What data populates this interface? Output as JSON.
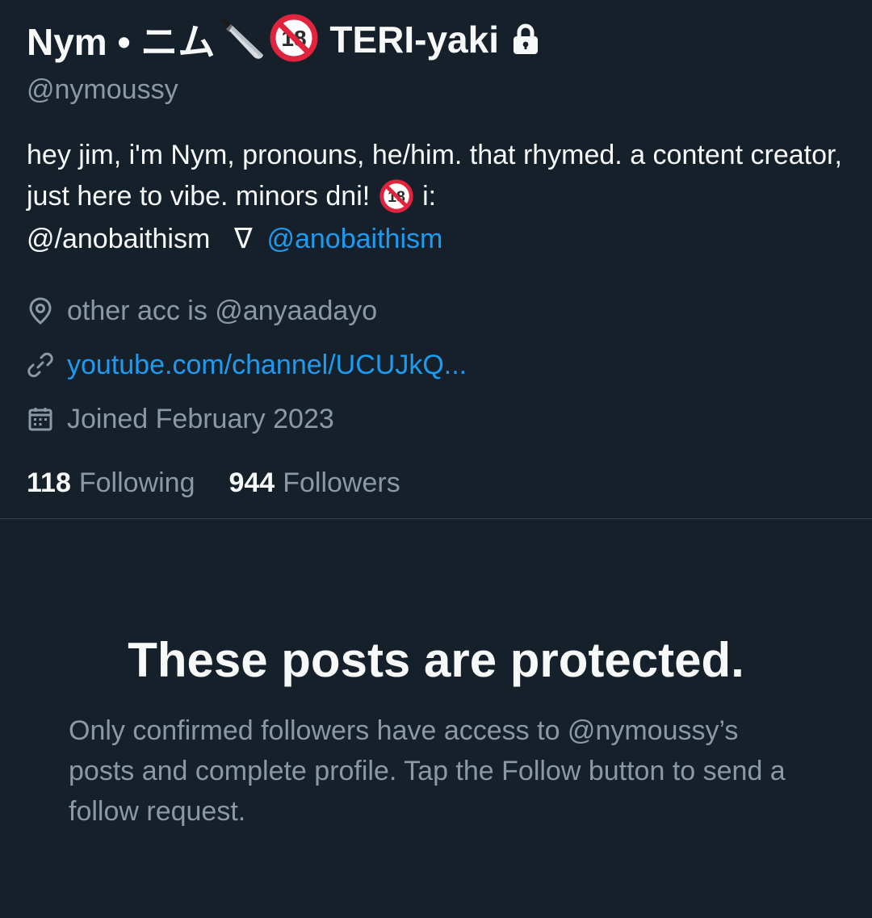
{
  "profile": {
    "display_name": "Nym • ニム",
    "display_name_suffix": "TERI-yaki",
    "emoji": [
      "kitchen-knife",
      "no-one-under-eighteen"
    ],
    "handle": "@nymoussy",
    "bio": {
      "line_a": "hey jim, i'm Nym, pronouns, he/him. that rhymed. a content creator, just here to vibe. minors dni!",
      "line_b": "i:",
      "line_c": "@/anobaithism",
      "glyph": "ᐁ",
      "mention": "@anobaithism"
    },
    "location": "other acc is @anyaadayo",
    "website": "youtube.com/channel/UCUJkQ...",
    "joined": "Joined February 2023",
    "following_count": "118",
    "following_label": "Following",
    "followers_count": "944",
    "followers_label": "Followers"
  },
  "protected_notice": {
    "title": "These posts are protected.",
    "description": "Only confirmed followers have access to @nymoussy’s posts and complete profile. Tap the Follow button to send a follow request."
  },
  "colors": {
    "background": "#15202b",
    "primary_text": "#f7f9f9",
    "secondary_text": "#8b98a5",
    "link": "#1d9bf0",
    "divider": "#38444d",
    "no_under_18_red": "#e0243d"
  },
  "icons": [
    "location-pin-icon",
    "link-icon",
    "calendar-icon",
    "lock-icon"
  ]
}
